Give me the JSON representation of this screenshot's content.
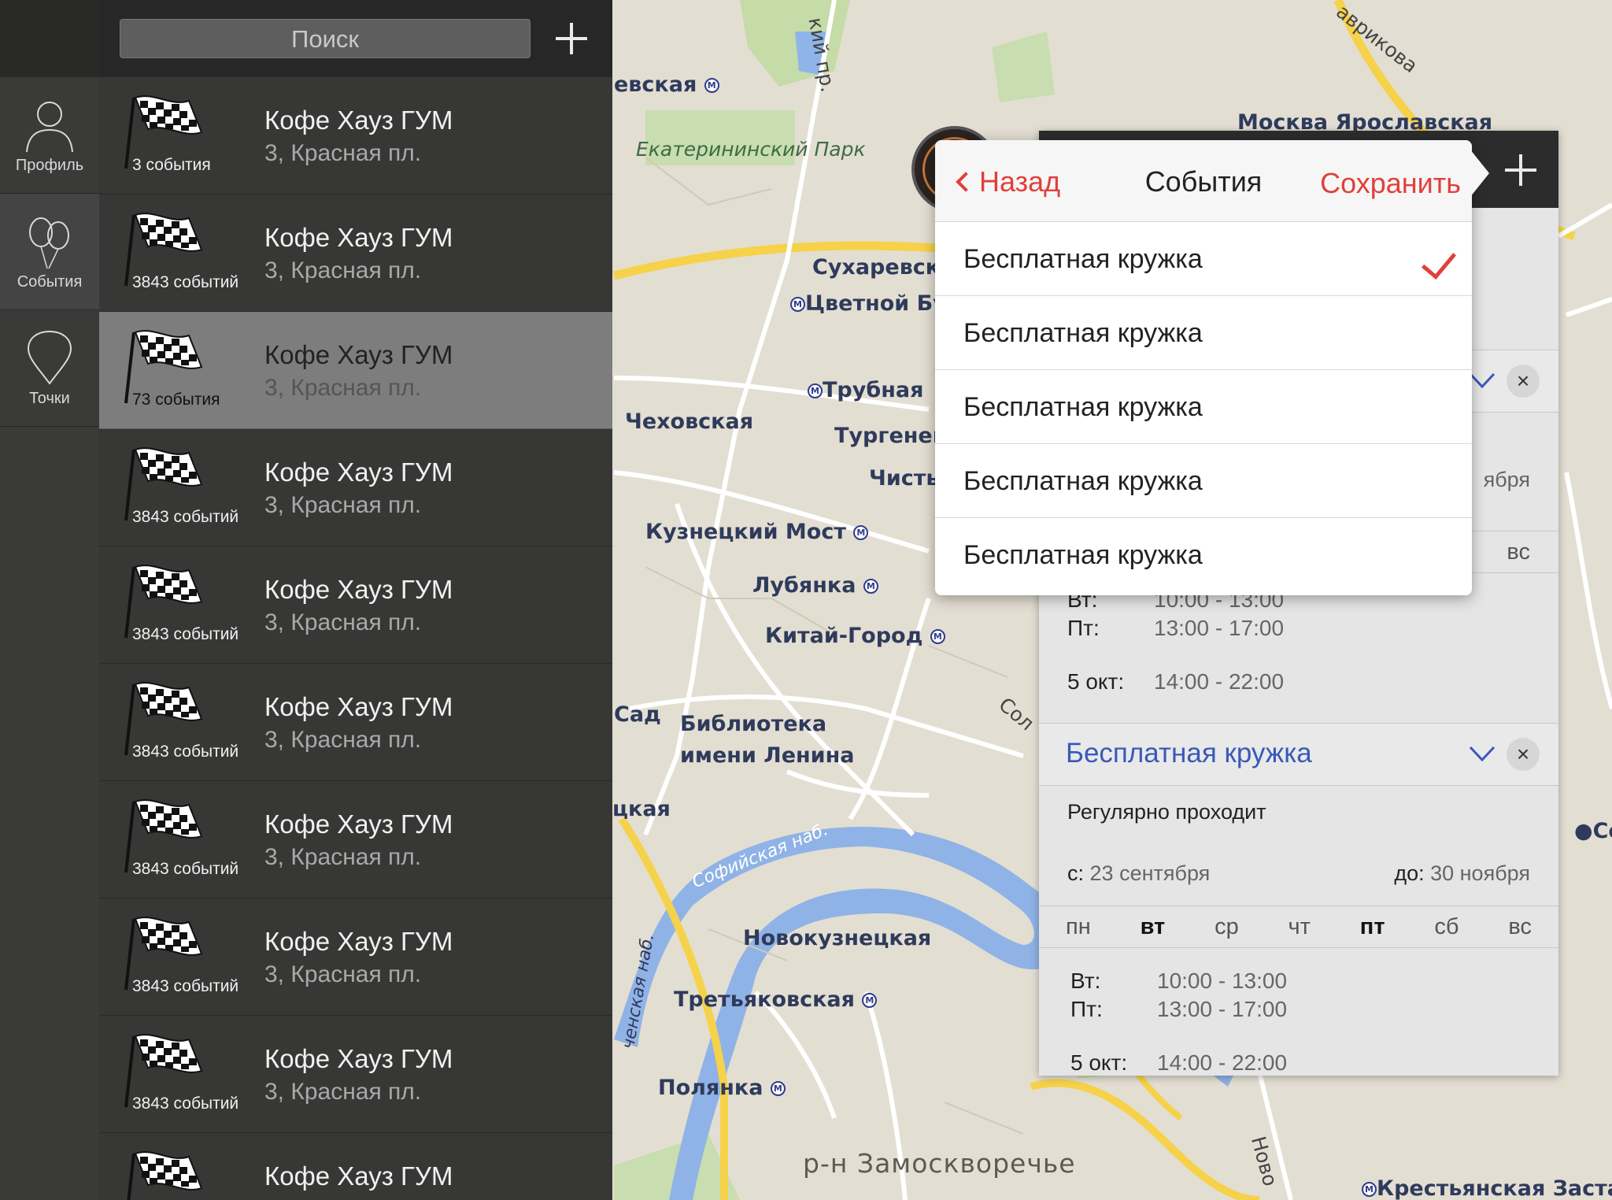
{
  "search": {
    "placeholder": "Поиск"
  },
  "rail": [
    {
      "label": "Профиль",
      "icon": "profile-icon"
    },
    {
      "label": "События",
      "icon": "balloons-icon"
    },
    {
      "label": "Точки",
      "icon": "map-pin-icon"
    }
  ],
  "places": [
    {
      "name": "Кофе Хауз ГУМ",
      "address": "3, Красная пл.",
      "count": "3 события"
    },
    {
      "name": "Кофе Хауз ГУМ",
      "address": "3, Красная пл.",
      "count": "3843 событий"
    },
    {
      "name": "Кофе Хауз ГУМ",
      "address": "3, Красная пл.",
      "count": "73 события"
    },
    {
      "name": "Кофе Хауз ГУМ",
      "address": "3, Красная пл.",
      "count": "3843 событий"
    },
    {
      "name": "Кофе Хауз ГУМ",
      "address": "3, Красная пл.",
      "count": "3843 событий"
    },
    {
      "name": "Кофе Хауз ГУМ",
      "address": "3, Красная пл.",
      "count": "3843 событий"
    },
    {
      "name": "Кофе Хауз ГУМ",
      "address": "3, Красная пл.",
      "count": "3843 событий"
    },
    {
      "name": "Кофе Хауз ГУМ",
      "address": "3, Красная пл.",
      "count": "3843 событий"
    },
    {
      "name": "Кофе Хауз ГУМ",
      "address": "3, Красная пл.",
      "count": "3843 событий"
    },
    {
      "name": "Кофе Хауз ГУМ",
      "address": "",
      "count": ""
    }
  ],
  "map_labels": {
    "krasnoselskaya": "евская",
    "ekaterininsky": "Екатерининский Парк",
    "moscow_yar": "Москва Ярославская",
    "gavrikova": "авр&#1080;кова",
    "sukharevskaya": "Сухаревска",
    "tsvetnoy": "Цветной Бу",
    "trubnaya": "Трубная",
    "chekhovskaya": "Чеховская",
    "turgenev": "Тургенев",
    "chist": "Чисть",
    "kuznetsky": "Кузнецкий Мост",
    "lubyanka": "Лубянка",
    "kitai_gorod": "Китай-Город",
    "sad": "Сад",
    "library": "Библиотека",
    "lenina": "имени Ленина",
    "ckaya": "цкая",
    "sofiyskaya": "Софийская наб.",
    "novokuznetskaya": "Новокузнецкая",
    "tretyakovskaya": "Третьяковская",
    "polyanka": "Полянка",
    "zamoskvorechye": "р-н Замоскворечье",
    "krestyanskaya": "Крестьянская Заста",
    "se": "Се",
    "novo": "Ново",
    "sol": "Сол",
    "prosp": "кий пр.",
    "naberezh": "ченская наб."
  },
  "popover": {
    "back": "Назад",
    "title": "События",
    "save": "Сохранить",
    "items": [
      {
        "label": "Бесплатная кружка",
        "checked": true
      },
      {
        "label": "Бесплатная кружка",
        "checked": false
      },
      {
        "label": "Бесплатная кружка",
        "checked": false
      },
      {
        "label": "Бесплатная кружка",
        "checked": false
      },
      {
        "label": "Бесплатная кружка",
        "checked": false
      }
    ]
  },
  "detail": {
    "partial_month": "ября",
    "partial_vs": "вс",
    "schedule_top": [
      {
        "day": "Вт:",
        "time": "10:00 - 13:00"
      },
      {
        "day": "Пт:",
        "time": "13:00 - 17:00"
      },
      {
        "day": "5 окт:",
        "time": "14:00 - 22:00"
      }
    ],
    "event": {
      "title": "Бесплатная кружка",
      "regular": "Регулярно проходит",
      "from_label": "с:",
      "from_value": "23 сентября",
      "to_label": "до:",
      "to_value": "30 ноября",
      "days": [
        "пн",
        "вт",
        "ср",
        "чт",
        "пт",
        "сб",
        "вс"
      ],
      "active_days": [
        "вт",
        "пт"
      ],
      "schedule": [
        {
          "day": "Вт:",
          "time": "10:00 - 13:00"
        },
        {
          "day": "Пт:",
          "time": "13:00 - 17:00"
        },
        {
          "day": "5 окт:",
          "time": "14:00 - 22:00"
        }
      ]
    }
  },
  "colors": {
    "accent_red": "#e0403a",
    "link_blue": "#3a59b8"
  }
}
